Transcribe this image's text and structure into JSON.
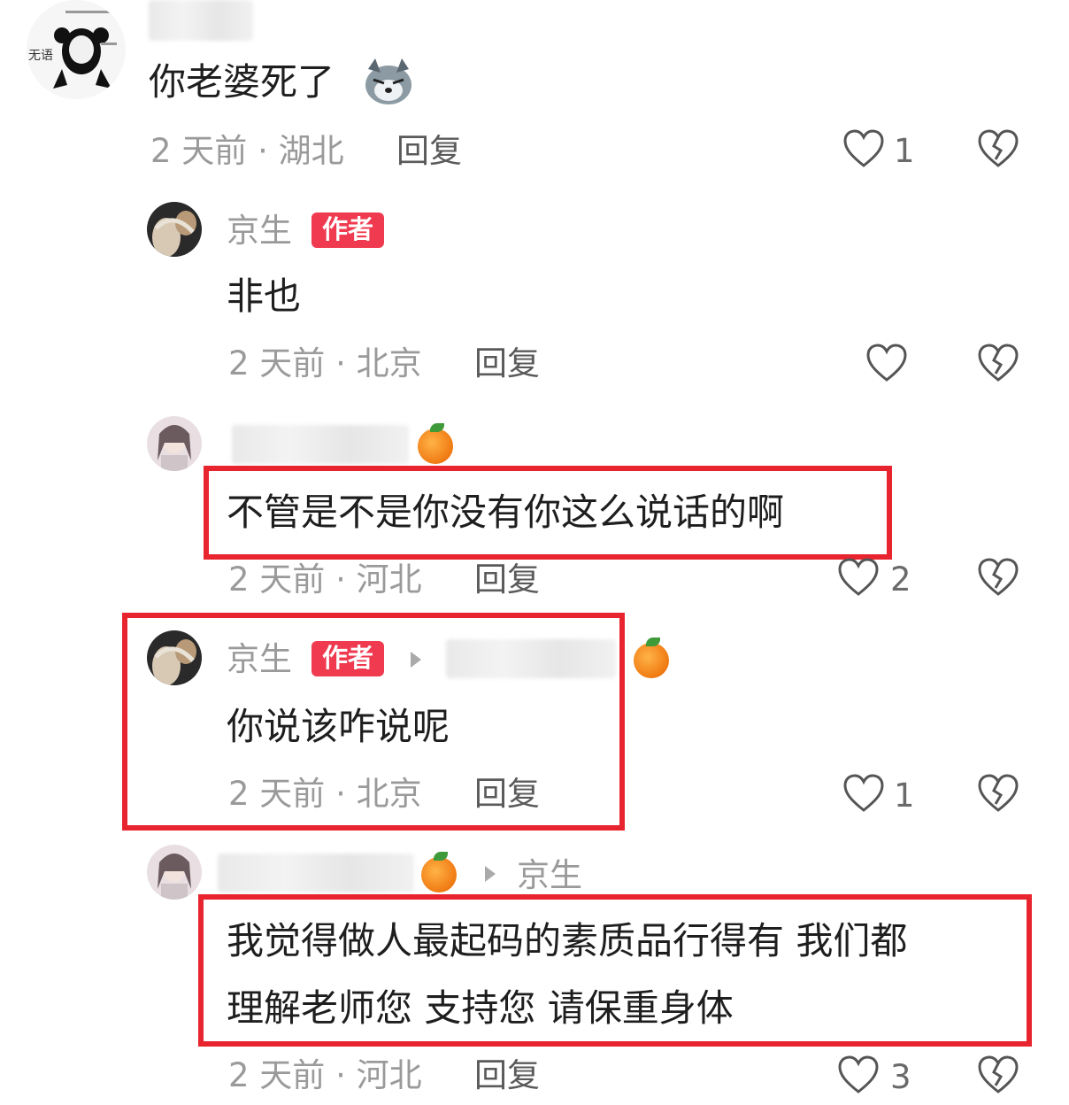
{
  "comments": [
    {
      "text": "你老婆死了",
      "meta": "2 天前 · 湖北",
      "reply_label": "回复",
      "like_count": "1"
    },
    {
      "username": "京生",
      "badge": "作者",
      "text": "非也",
      "meta": "2 天前 · 北京",
      "reply_label": "回复",
      "like_count": ""
    },
    {
      "text": "不管是不是你没有你这么说话的啊",
      "meta": "2 天前 · 河北",
      "reply_label": "回复",
      "like_count": "2"
    },
    {
      "username": "京生",
      "badge": "作者",
      "text": "你说该咋说呢",
      "meta": "2 天前 · 北京",
      "reply_label": "回复",
      "like_count": "1"
    },
    {
      "reply_to": "京生",
      "text_line1": "我觉得做人最起码的素质品行得有 我们都",
      "text_line2": "理解老师您 支持您 请保重身体",
      "meta": "2 天前 · 河北",
      "reply_label": "回复",
      "like_count": "3"
    }
  ],
  "avatar_sticker": {
    "label": "无语"
  },
  "colors": {
    "highlight_border": "#e8252f",
    "author_badge": "#ef3a4f"
  },
  "icons": [
    "heart-icon",
    "broken-heart-icon",
    "play-arrow-icon",
    "husky-emoji-icon",
    "orange-emoji-icon"
  ]
}
